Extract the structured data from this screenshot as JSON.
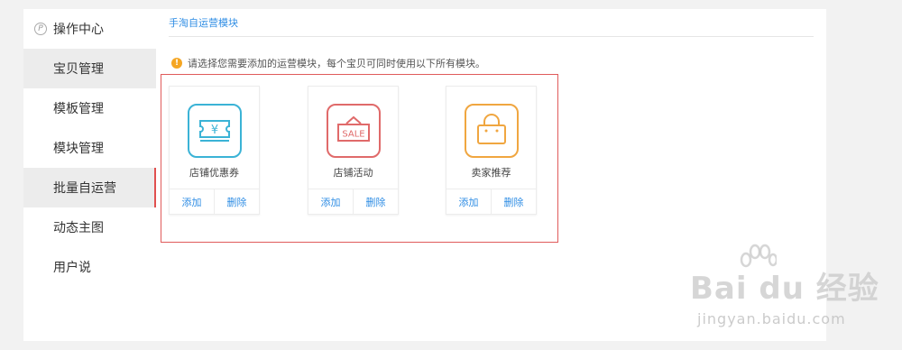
{
  "sidebar": {
    "header": "操作中心",
    "header_icon": "P",
    "items": [
      {
        "label": "宝贝管理"
      },
      {
        "label": "模板管理"
      },
      {
        "label": "模块管理"
      },
      {
        "label": "批量自运营"
      },
      {
        "label": "动态主图"
      },
      {
        "label": "用户说"
      }
    ]
  },
  "main": {
    "title": "手淘自运营模块",
    "notice": "请选择您需要添加的运营模块，每个宝贝可同时使用以下所有模块。",
    "notice_icon": "!",
    "cards": [
      {
        "label": "店铺优惠券",
        "icon": "coupon-icon",
        "color": "#3bb3d6",
        "glyph": "¥",
        "add": "添加",
        "delete": "删除"
      },
      {
        "label": "店铺活动",
        "icon": "sale-sign-icon",
        "color": "#e06a6a",
        "glyph": "SALE",
        "add": "添加",
        "delete": "删除"
      },
      {
        "label": "卖家推荐",
        "icon": "shopping-bag-icon",
        "color": "#f0a640",
        "add": "添加",
        "delete": "删除"
      }
    ]
  },
  "watermark": {
    "logo_text": "Bai du 经验",
    "url": "jingyan.baidu.com"
  },
  "colors": {
    "link": "#2f8de4",
    "highlight_frame": "#e05b5b",
    "active_bar": "#e0504f",
    "warning": "#f5a623"
  }
}
